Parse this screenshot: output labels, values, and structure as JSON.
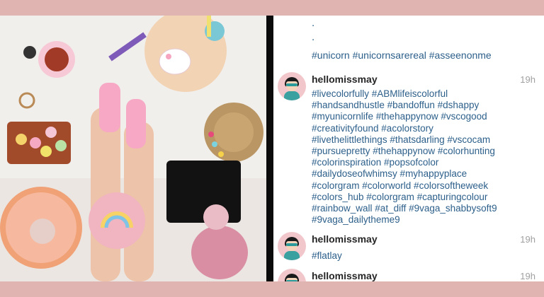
{
  "feed": {
    "first_caption": "#unicorn #unicornsarereal #asseenonme",
    "dots": [
      ".",
      "."
    ],
    "comments": [
      {
        "username": "hellomissmay",
        "time": "19h",
        "lines": [
          "#livecolorfully #ABMlifeiscolorful",
          "#handsandhustle #bandoffun #dshappy",
          "#myunicornlife #thehappynow #vscogood",
          "#creativityfound #acolorstory",
          "#livethelittlethings #thatsdarling #vscocam",
          "#pursuepretty #thehappynow #colorhunting",
          "#colorinspiration #popsofcolor",
          "#dailydoseofwhimsy #myhappyplace",
          "#colorgram #colorworld #colorsoftheweek",
          "#colors_hub #colorgram #capturingcolour",
          "#rainbow_wall #at_diff #9vaga_shabbysoft9",
          "#9vaga_dailytheme9"
        ]
      },
      {
        "username": "hellomissmay",
        "time": "19h",
        "lines": [
          "#flatlay"
        ]
      },
      {
        "username": "hellomissmay",
        "time": "19h",
        "lines": []
      }
    ]
  },
  "colors": {
    "background": "#e0b4b0",
    "hashtag": "#2c5f8a",
    "username": "#262626",
    "time": "#a0a0a0"
  },
  "icons": [
    "avatar-illustration"
  ]
}
